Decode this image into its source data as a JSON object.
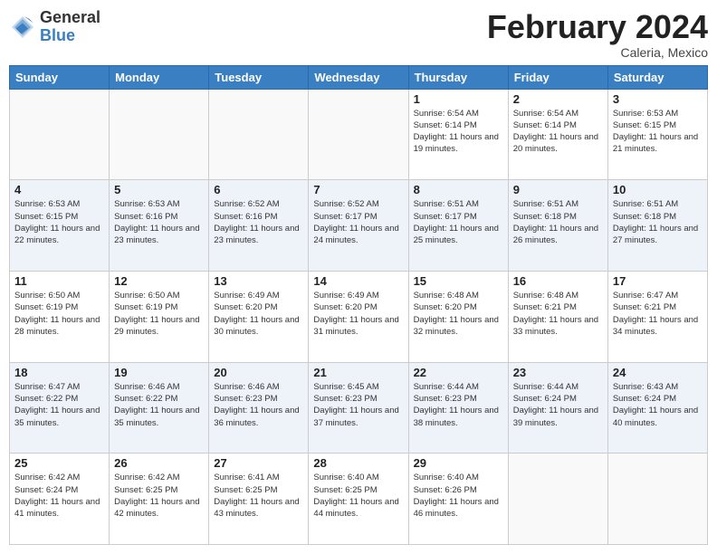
{
  "header": {
    "logo_general": "General",
    "logo_blue": "Blue",
    "month_title": "February 2024",
    "location": "Caleria, Mexico"
  },
  "days_of_week": [
    "Sunday",
    "Monday",
    "Tuesday",
    "Wednesday",
    "Thursday",
    "Friday",
    "Saturday"
  ],
  "weeks": [
    [
      {
        "day": "",
        "info": ""
      },
      {
        "day": "",
        "info": ""
      },
      {
        "day": "",
        "info": ""
      },
      {
        "day": "",
        "info": ""
      },
      {
        "day": "1",
        "info": "Sunrise: 6:54 AM\nSunset: 6:14 PM\nDaylight: 11 hours and 19 minutes."
      },
      {
        "day": "2",
        "info": "Sunrise: 6:54 AM\nSunset: 6:14 PM\nDaylight: 11 hours and 20 minutes."
      },
      {
        "day": "3",
        "info": "Sunrise: 6:53 AM\nSunset: 6:15 PM\nDaylight: 11 hours and 21 minutes."
      }
    ],
    [
      {
        "day": "4",
        "info": "Sunrise: 6:53 AM\nSunset: 6:15 PM\nDaylight: 11 hours and 22 minutes."
      },
      {
        "day": "5",
        "info": "Sunrise: 6:53 AM\nSunset: 6:16 PM\nDaylight: 11 hours and 23 minutes."
      },
      {
        "day": "6",
        "info": "Sunrise: 6:52 AM\nSunset: 6:16 PM\nDaylight: 11 hours and 23 minutes."
      },
      {
        "day": "7",
        "info": "Sunrise: 6:52 AM\nSunset: 6:17 PM\nDaylight: 11 hours and 24 minutes."
      },
      {
        "day": "8",
        "info": "Sunrise: 6:51 AM\nSunset: 6:17 PM\nDaylight: 11 hours and 25 minutes."
      },
      {
        "day": "9",
        "info": "Sunrise: 6:51 AM\nSunset: 6:18 PM\nDaylight: 11 hours and 26 minutes."
      },
      {
        "day": "10",
        "info": "Sunrise: 6:51 AM\nSunset: 6:18 PM\nDaylight: 11 hours and 27 minutes."
      }
    ],
    [
      {
        "day": "11",
        "info": "Sunrise: 6:50 AM\nSunset: 6:19 PM\nDaylight: 11 hours and 28 minutes."
      },
      {
        "day": "12",
        "info": "Sunrise: 6:50 AM\nSunset: 6:19 PM\nDaylight: 11 hours and 29 minutes."
      },
      {
        "day": "13",
        "info": "Sunrise: 6:49 AM\nSunset: 6:20 PM\nDaylight: 11 hours and 30 minutes."
      },
      {
        "day": "14",
        "info": "Sunrise: 6:49 AM\nSunset: 6:20 PM\nDaylight: 11 hours and 31 minutes."
      },
      {
        "day": "15",
        "info": "Sunrise: 6:48 AM\nSunset: 6:20 PM\nDaylight: 11 hours and 32 minutes."
      },
      {
        "day": "16",
        "info": "Sunrise: 6:48 AM\nSunset: 6:21 PM\nDaylight: 11 hours and 33 minutes."
      },
      {
        "day": "17",
        "info": "Sunrise: 6:47 AM\nSunset: 6:21 PM\nDaylight: 11 hours and 34 minutes."
      }
    ],
    [
      {
        "day": "18",
        "info": "Sunrise: 6:47 AM\nSunset: 6:22 PM\nDaylight: 11 hours and 35 minutes."
      },
      {
        "day": "19",
        "info": "Sunrise: 6:46 AM\nSunset: 6:22 PM\nDaylight: 11 hours and 35 minutes."
      },
      {
        "day": "20",
        "info": "Sunrise: 6:46 AM\nSunset: 6:23 PM\nDaylight: 11 hours and 36 minutes."
      },
      {
        "day": "21",
        "info": "Sunrise: 6:45 AM\nSunset: 6:23 PM\nDaylight: 11 hours and 37 minutes."
      },
      {
        "day": "22",
        "info": "Sunrise: 6:44 AM\nSunset: 6:23 PM\nDaylight: 11 hours and 38 minutes."
      },
      {
        "day": "23",
        "info": "Sunrise: 6:44 AM\nSunset: 6:24 PM\nDaylight: 11 hours and 39 minutes."
      },
      {
        "day": "24",
        "info": "Sunrise: 6:43 AM\nSunset: 6:24 PM\nDaylight: 11 hours and 40 minutes."
      }
    ],
    [
      {
        "day": "25",
        "info": "Sunrise: 6:42 AM\nSunset: 6:24 PM\nDaylight: 11 hours and 41 minutes."
      },
      {
        "day": "26",
        "info": "Sunrise: 6:42 AM\nSunset: 6:25 PM\nDaylight: 11 hours and 42 minutes."
      },
      {
        "day": "27",
        "info": "Sunrise: 6:41 AM\nSunset: 6:25 PM\nDaylight: 11 hours and 43 minutes."
      },
      {
        "day": "28",
        "info": "Sunrise: 6:40 AM\nSunset: 6:25 PM\nDaylight: 11 hours and 44 minutes."
      },
      {
        "day": "29",
        "info": "Sunrise: 6:40 AM\nSunset: 6:26 PM\nDaylight: 11 hours and 46 minutes."
      },
      {
        "day": "",
        "info": ""
      },
      {
        "day": "",
        "info": ""
      }
    ]
  ]
}
